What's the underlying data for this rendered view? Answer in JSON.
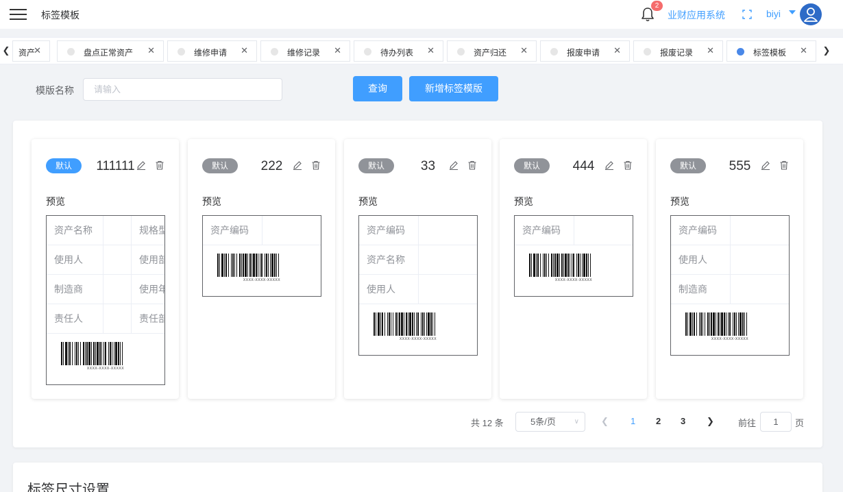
{
  "header": {
    "title": "标签模板",
    "notification_count": "2",
    "system_link": "业财应用系统",
    "user_name": "biyi"
  },
  "tabs": [
    {
      "label": "资产",
      "active": false
    },
    {
      "label": "盘点正常资产",
      "active": false
    },
    {
      "label": "维修申请",
      "active": false
    },
    {
      "label": "维修记录",
      "active": false
    },
    {
      "label": "待办列表",
      "active": false
    },
    {
      "label": "资产归还",
      "active": false
    },
    {
      "label": "报废申请",
      "active": false
    },
    {
      "label": "报废记录",
      "active": false
    },
    {
      "label": "标签模板",
      "active": true
    }
  ],
  "search": {
    "label": "模版名称",
    "placeholder": "请输入",
    "query_button": "查询",
    "add_button": "新增标签模版"
  },
  "cards": [
    {
      "badge": "默认",
      "is_default": true,
      "name": "111111",
      "preview_label": "预览",
      "rows": [
        [
          "资产名称",
          "",
          "规格型号"
        ],
        [
          "使用人",
          "",
          "使用部门"
        ],
        [
          "制造商",
          "",
          "使用年限"
        ],
        [
          "责任人",
          "",
          "责任部门"
        ]
      ],
      "barcode_text": "XXXX-XXXX-XXXXX"
    },
    {
      "badge": "默认",
      "is_default": false,
      "name": "222",
      "preview_label": "预览",
      "rows": [
        [
          "资产编码",
          ""
        ]
      ],
      "barcode_text": "XXXX-XXXX-XXXXX"
    },
    {
      "badge": "默认",
      "is_default": false,
      "name": "33",
      "preview_label": "预览",
      "rows": [
        [
          "资产编码",
          ""
        ],
        [
          "资产名称",
          ""
        ],
        [
          "使用人",
          ""
        ]
      ],
      "barcode_text": "XXXX-XXXX-XXXXX"
    },
    {
      "badge": "默认",
      "is_default": false,
      "name": "444",
      "preview_label": "预览",
      "rows": [
        [
          "资产编码",
          ""
        ]
      ],
      "barcode_text": "XXXX-XXXX-XXXXX"
    },
    {
      "badge": "默认",
      "is_default": false,
      "name": "555",
      "preview_label": "预览",
      "rows": [
        [
          "资产编码",
          ""
        ],
        [
          "使用人",
          ""
        ],
        [
          "制造商",
          ""
        ]
      ],
      "barcode_text": "XXXX-XXXX-XXXXX"
    }
  ],
  "pagination": {
    "total_text": "共 12 条",
    "page_size": "5条/页",
    "pages": [
      "1",
      "2",
      "3"
    ],
    "current_page": "1",
    "goto_label": "前往",
    "goto_value": "1",
    "goto_suffix": "页"
  },
  "size_section": {
    "title": "标签尺寸设置"
  },
  "colors": {
    "primary": "#409eff",
    "default_badge": "#409eff",
    "normal_badge": "#909399",
    "active_tab_dot": "#4a88e8",
    "notification_badge": "#f56c6c"
  },
  "icons": {
    "menu": "hamburger-icon",
    "notification": "bell-icon",
    "fullscreen": "fullscreen-icon",
    "user": "user-avatar-icon",
    "edit": "edit-icon",
    "delete": "trash-icon",
    "tab_close": "close-icon"
  }
}
